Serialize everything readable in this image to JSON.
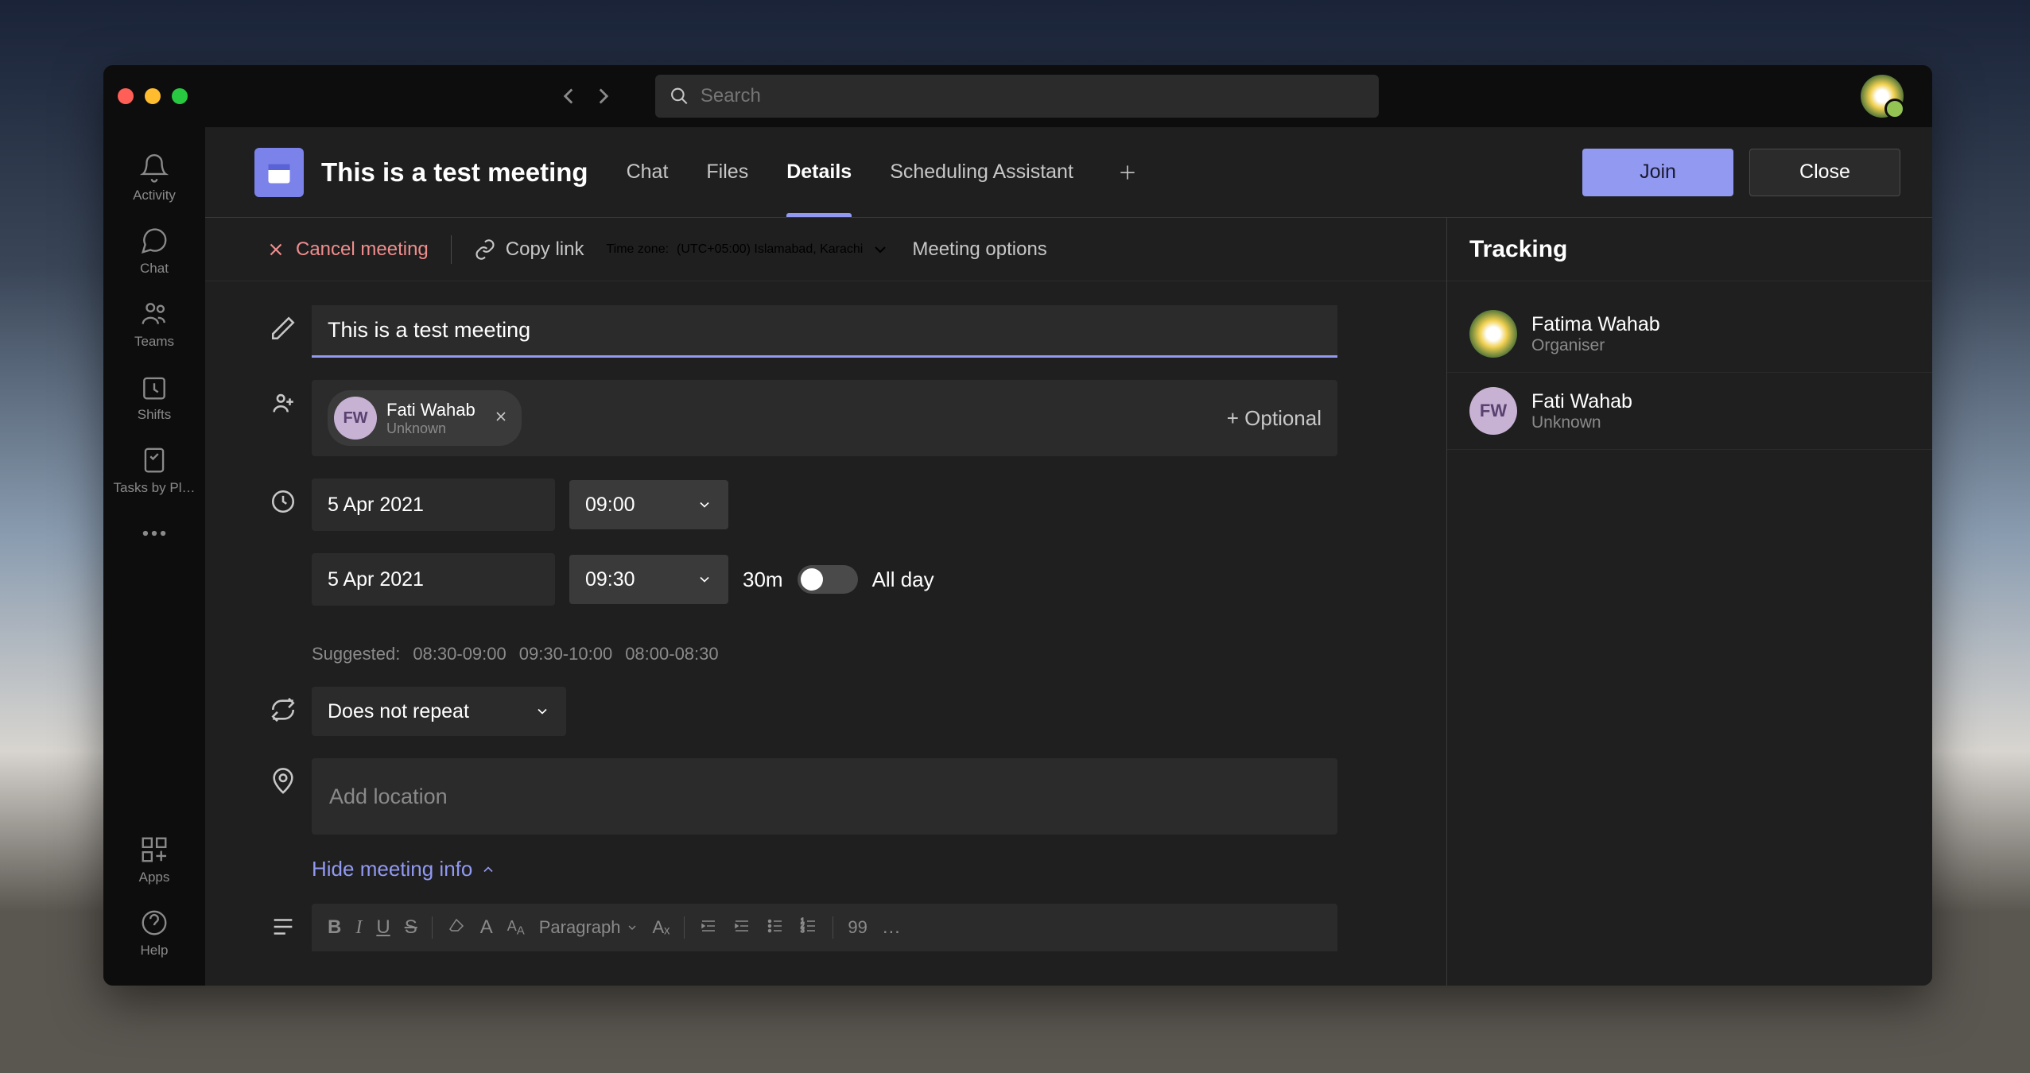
{
  "search": {
    "placeholder": "Search"
  },
  "rail": {
    "activity": "Activity",
    "chat": "Chat",
    "teams": "Teams",
    "shifts": "Shifts",
    "tasks": "Tasks by Pl…",
    "apps": "Apps",
    "help": "Help"
  },
  "header": {
    "title": "This is a test meeting",
    "tabs": {
      "chat": "Chat",
      "files": "Files",
      "details": "Details",
      "sched": "Scheduling Assistant"
    },
    "join": "Join",
    "close": "Close"
  },
  "toolbar": {
    "cancel": "Cancel meeting",
    "copy": "Copy link",
    "tz_label": "Time zone:",
    "tz_value": "(UTC+05:00) Islamabad, Karachi",
    "options": "Meeting options"
  },
  "form": {
    "title_value": "This is a test meeting",
    "attendee": {
      "initials": "FW",
      "name": "Fati Wahab",
      "status": "Unknown"
    },
    "optional": "+ Optional",
    "start_date": "5 Apr 2021",
    "start_time": "09:00",
    "end_date": "5 Apr 2021",
    "end_time": "09:30",
    "duration": "30m",
    "allday": "All day",
    "suggested_label": "Suggested:",
    "suggested": [
      "08:30-09:00",
      "09:30-10:00",
      "08:00-08:30"
    ],
    "repeat": "Does not repeat",
    "location_placeholder": "Add location",
    "hide_info": "Hide meeting info",
    "paragraph": "Paragraph"
  },
  "tracking": {
    "title": "Tracking",
    "items": [
      {
        "name": "Fatima Wahab",
        "role": "Organiser",
        "initials": ""
      },
      {
        "name": "Fati Wahab",
        "role": "Unknown",
        "initials": "FW"
      }
    ]
  }
}
